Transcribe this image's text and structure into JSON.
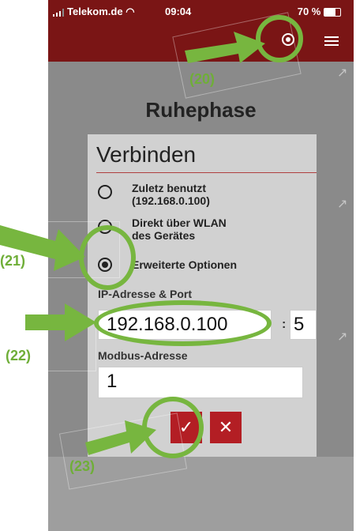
{
  "status": {
    "carrier": "Telekom.de",
    "time": "09:04",
    "battery": "70 %"
  },
  "page": {
    "title": "Ruhephase"
  },
  "dialog": {
    "title": "Verbinden",
    "options": [
      {
        "label": "Zuletz benutzt\n(192.168.0.100)",
        "checked": false
      },
      {
        "label": "Direkt über WLAN\ndes Gerätes",
        "checked": false
      },
      {
        "label": "Erweiterte Optionen",
        "checked": true
      }
    ],
    "ip_label": "IP-Adresse & Port",
    "ip_value": "192.168.0.100",
    "port_value": "5",
    "port_separator": ":",
    "modbus_label": "Modbus-Adresse",
    "modbus_value": "1",
    "confirm_symbol": "✓",
    "cancel_symbol": "✕"
  },
  "annotations": [
    {
      "label": "(20)"
    },
    {
      "label": "(21)"
    },
    {
      "label": "(22)"
    },
    {
      "label": "(23)"
    }
  ],
  "colors": {
    "header": "#7a1515",
    "accent_red": "#b31e24",
    "annotation_green": "#77b63f"
  }
}
